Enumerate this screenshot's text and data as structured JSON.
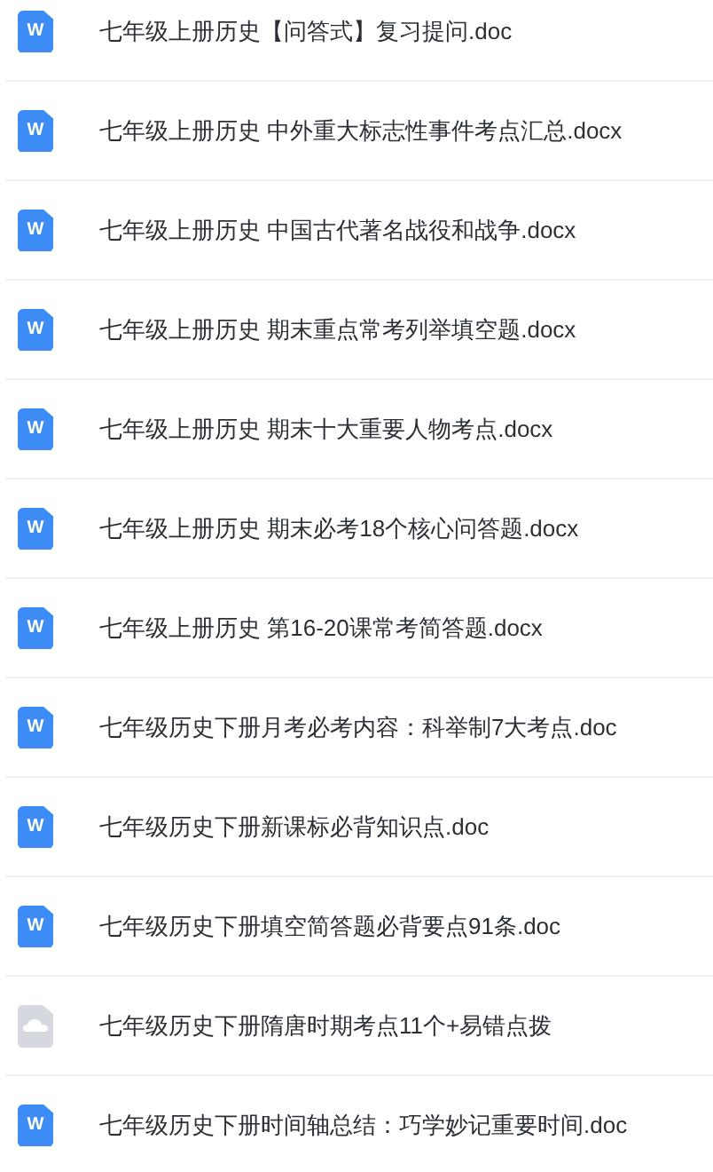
{
  "files": [
    {
      "name": "七年级上册历史【问答式】复习提问.doc",
      "kind": "word",
      "icon_label": "W"
    },
    {
      "name": "七年级上册历史 中外重大标志性事件考点汇总.docx",
      "kind": "word",
      "icon_label": "W"
    },
    {
      "name": "七年级上册历史 中国古代著名战役和战争.docx",
      "kind": "word",
      "icon_label": "W"
    },
    {
      "name": "七年级上册历史 期末重点常考列举填空题.docx",
      "kind": "word",
      "icon_label": "W"
    },
    {
      "name": "七年级上册历史 期末十大重要人物考点.docx",
      "kind": "word",
      "icon_label": "W"
    },
    {
      "name": "七年级上册历史 期末必考18个核心问答题.docx",
      "kind": "word",
      "icon_label": "W"
    },
    {
      "name": "七年级上册历史 第16-20课常考简答题.docx",
      "kind": "word",
      "icon_label": "W"
    },
    {
      "name": "七年级历史下册月考必考内容：科举制7大考点.doc",
      "kind": "word",
      "icon_label": "W"
    },
    {
      "name": "七年级历史下册新课标必背知识点.doc",
      "kind": "word",
      "icon_label": "W"
    },
    {
      "name": "七年级历史下册填空简答题必背要点91条.doc",
      "kind": "word",
      "icon_label": "W"
    },
    {
      "name": "七年级历史下册隋唐时期考点11个+易错点拨",
      "kind": "cloud"
    },
    {
      "name": "七年级历史下册时间轴总结：巧学妙记重要时间.doc",
      "kind": "word",
      "icon_label": "W"
    }
  ]
}
